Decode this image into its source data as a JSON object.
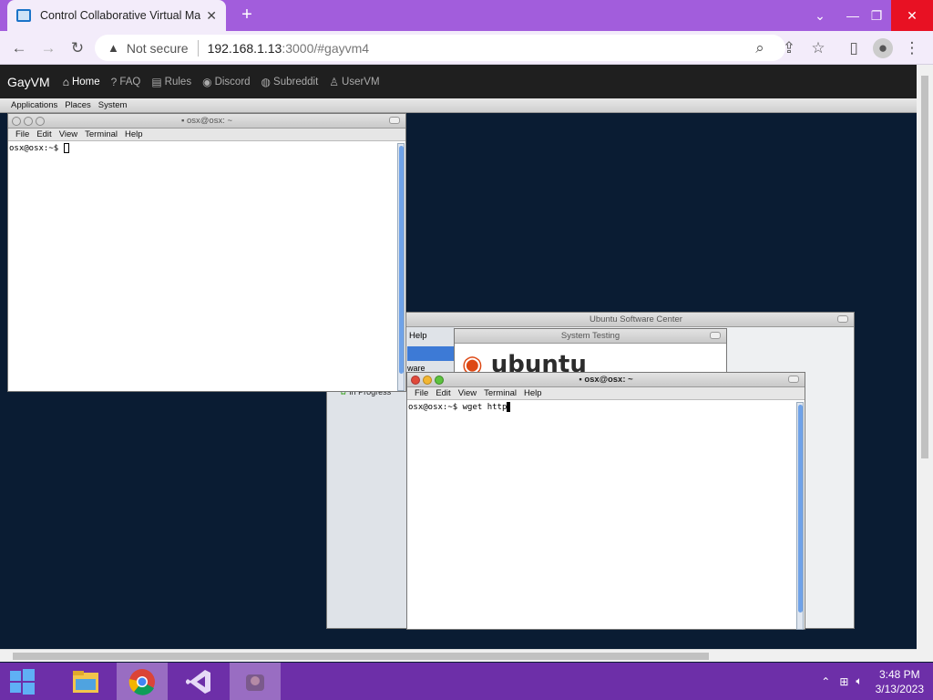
{
  "browser": {
    "tab_title": "Control Collaborative Virtual Ma",
    "tab_close": "✕",
    "new_tab": "+",
    "not_secure": "Not secure",
    "url_host": "192.168.1.13",
    "url_path": ":3000/#gayvm4"
  },
  "site_nav": {
    "brand": "GayVM",
    "links": [
      "Home",
      "FAQ",
      "Rules",
      "Discord",
      "Subreddit",
      "UserVM"
    ]
  },
  "vm": {
    "panel": [
      "Applications",
      "Places",
      "System"
    ],
    "terminal1": {
      "title": "osx@osx: ~",
      "menu": [
        "File",
        "Edit",
        "View",
        "Terminal",
        "Help"
      ],
      "prompt": "osx@osx:~$ "
    },
    "software_center": {
      "title": "Ubuntu Software Center",
      "menu_help": "Help",
      "sidebar_item": "ware",
      "in_progress": "In Progress"
    },
    "system_testing": {
      "title": "System Testing",
      "logo_text": "ubuntu"
    },
    "terminal2": {
      "title": "osx@osx: ~",
      "menu": [
        "File",
        "Edit",
        "View",
        "Terminal",
        "Help"
      ],
      "prompt": "osx@osx:~$ wget http"
    }
  },
  "taskbar": {
    "time": "3:48 PM",
    "date": "3/13/2023"
  },
  "colors": {
    "chrome_frame": "#a25ddc",
    "taskbar": "#6d2fa8",
    "vm_desktop": "#0a1c33"
  }
}
